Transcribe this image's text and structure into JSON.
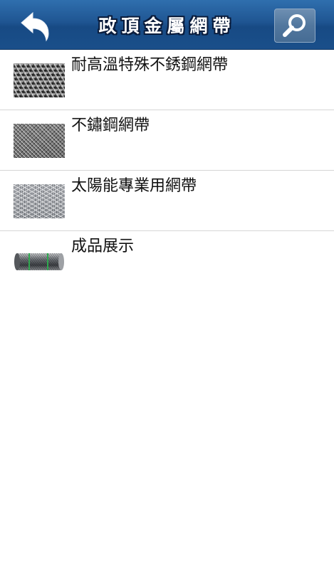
{
  "header": {
    "title": "政頂金屬網帶",
    "back_icon": "back-arrow-icon",
    "search_icon": "search-icon",
    "colors": {
      "bar": "#1f5592",
      "search_button": "#52779e",
      "title_text": "#ffffff"
    }
  },
  "list": {
    "items": [
      {
        "label": "耐高溫特殊不銹鋼網帶",
        "thumbnail": "heat-resistant-mesh-belt-thumbnail"
      },
      {
        "label": "不鏽鋼網帶",
        "thumbnail": "stainless-mesh-belt-thumbnail"
      },
      {
        "label": "太陽能專業用網帶",
        "thumbnail": "solar-mesh-belt-thumbnail"
      },
      {
        "label": "成品展示",
        "thumbnail": "mesh-belt-roll-thumbnail"
      }
    ]
  }
}
